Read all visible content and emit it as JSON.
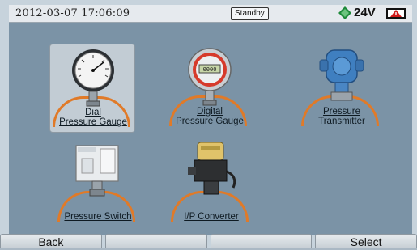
{
  "status": {
    "datetime": "2012-03-07  17:06:09",
    "mode": "Standby",
    "voltage": "24V",
    "battery_state": "warning",
    "accent": "#e07a28"
  },
  "devices": [
    {
      "line1": "Dial",
      "line2": "Pressure Gauge",
      "selected": true
    },
    {
      "line1": "Digital",
      "line2": "Pressure Gauge",
      "selected": false
    },
    {
      "line1": "Pressure",
      "line2": "Transmitter",
      "selected": false
    },
    {
      "line1": "",
      "line2": "Pressure Switch",
      "selected": false
    },
    {
      "line1": "",
      "line2": "I/P Converter",
      "selected": false
    }
  ],
  "softkeys": [
    "Back",
    "",
    "",
    "Select"
  ]
}
